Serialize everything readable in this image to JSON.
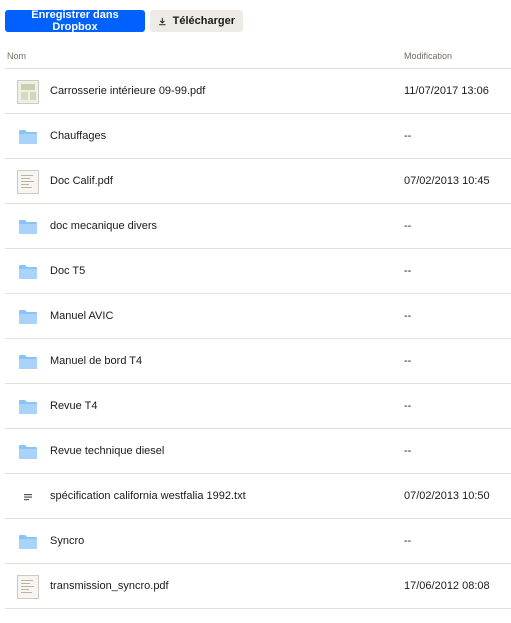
{
  "toolbar": {
    "save_label": "Enregistrer dans Dropbox",
    "download_label": "Télécharger"
  },
  "header": {
    "name_label": "Nom",
    "modified_label": "Modification"
  },
  "files": [
    {
      "name": "Carrosserie intérieure 09-99.pdf",
      "modified": "11/07/2017 13:06",
      "type": "pdf-thumb-colored"
    },
    {
      "name": "Chauffages",
      "modified": "--",
      "type": "folder"
    },
    {
      "name": "Doc Calif.pdf",
      "modified": "07/02/2013 10:45",
      "type": "pdf-thumb"
    },
    {
      "name": "doc mecanique divers",
      "modified": "--",
      "type": "folder"
    },
    {
      "name": "Doc T5",
      "modified": "--",
      "type": "folder"
    },
    {
      "name": "Manuel AVIC",
      "modified": "--",
      "type": "folder"
    },
    {
      "name": "Manuel de bord T4",
      "modified": "--",
      "type": "folder"
    },
    {
      "name": "Revue T4",
      "modified": "--",
      "type": "folder"
    },
    {
      "name": "Revue technique diesel",
      "modified": "--",
      "type": "folder"
    },
    {
      "name": "spécification california westfalia 1992.txt",
      "modified": "07/02/2013 10:50",
      "type": "text"
    },
    {
      "name": "Syncro",
      "modified": "--",
      "type": "folder"
    },
    {
      "name": "transmission_syncro.pdf",
      "modified": "17/06/2012 08:08",
      "type": "pdf-thumb"
    }
  ],
  "colors": {
    "primary": "#0061fe",
    "folder": "#8ac3f5",
    "divider": "#e4e1dd"
  }
}
